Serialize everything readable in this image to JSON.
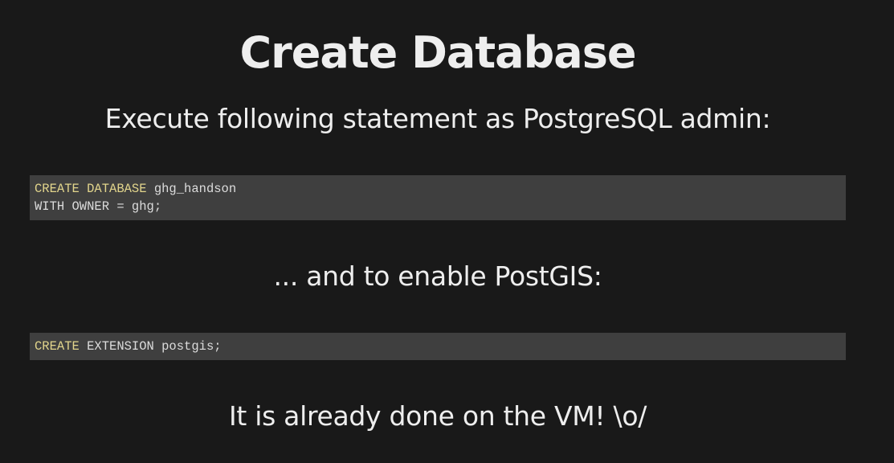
{
  "slide": {
    "title": "Create Database",
    "intro": "Execute following statement as PostgreSQL admin:",
    "code_block_1": {
      "line1_kw": "CREATE DATABASE",
      "line1_rest": " ghg_handson",
      "line2": "WITH OWNER = ghg;"
    },
    "middle": "... and to enable PostGIS:",
    "code_block_2": {
      "line1_kw": "CREATE",
      "line1_rest": " EXTENSION postgis;"
    },
    "footer": "It is already done on the VM! \\o/"
  },
  "colors": {
    "background": "#191919",
    "text": "#eeeeee",
    "code_background": "#3f3f3f",
    "code_keyword": "#e2d58c",
    "code_text": "#dcdcdc"
  }
}
